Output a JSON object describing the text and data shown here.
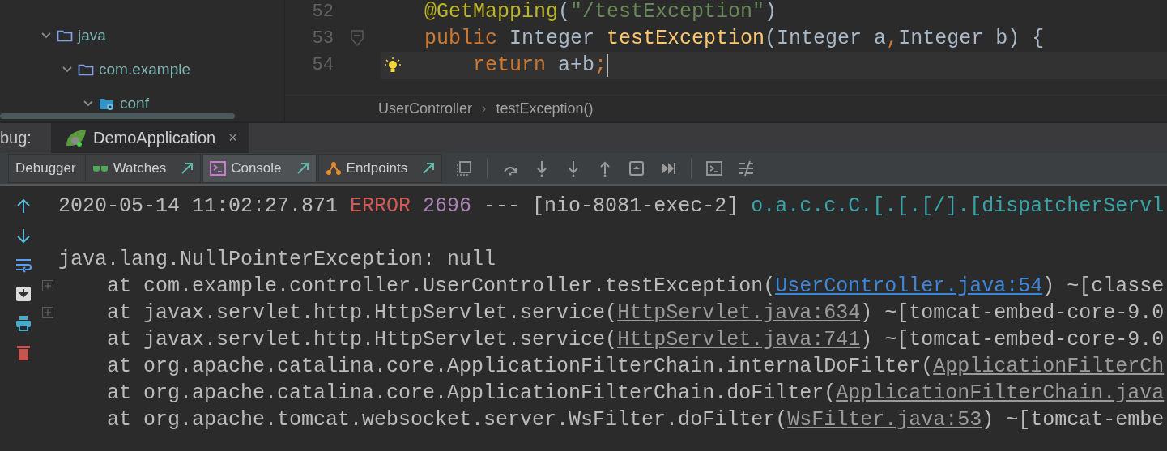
{
  "project_tree": [
    {
      "label": "java",
      "kind": "source",
      "expanded": true,
      "children": [
        {
          "label": "com.example",
          "kind": "package",
          "expanded": true,
          "children": [
            {
              "label": "conf",
              "kind": "config",
              "expanded": true
            }
          ]
        }
      ]
    }
  ],
  "editor": {
    "lines": [
      {
        "number": "52",
        "current": false,
        "fold_marker": false,
        "tokens": [
          {
            "kind": "annotation",
            "text": "@GetMapping"
          },
          {
            "kind": "plain",
            "text": "("
          },
          {
            "kind": "string",
            "text": "\"/testException\""
          },
          {
            "kind": "plain",
            "text": ")"
          }
        ]
      },
      {
        "number": "53",
        "current": false,
        "fold_marker": true,
        "tokens": [
          {
            "kind": "keyword",
            "text": "public"
          },
          {
            "kind": "plain",
            "text": " Integer "
          },
          {
            "kind": "method",
            "text": "testException"
          },
          {
            "kind": "plain",
            "text": "(Integer a"
          },
          {
            "kind": "keyword",
            "text": ","
          },
          {
            "kind": "plain",
            "text": "Integer b) {"
          }
        ]
      },
      {
        "number": "54",
        "current": true,
        "fold_marker": false,
        "tokens": [
          {
            "kind": "keyword",
            "text": "    return"
          },
          {
            "kind": "plain",
            "text": " a+b"
          },
          {
            "kind": "keyword",
            "text": ";"
          }
        ]
      }
    ],
    "breadcrumbs": [
      {
        "label": "UserController",
        "separator": "›"
      },
      {
        "label": "testException()"
      }
    ]
  },
  "debug": {
    "label": "bug:",
    "session_tab": {
      "label": "DemoApplication",
      "close": "×"
    },
    "tabs": [
      {
        "label": "Debugger",
        "selected": false,
        "pin": false,
        "kind": "debugger"
      },
      {
        "label": "Watches",
        "selected": false,
        "pin": true,
        "kind": "watches"
      },
      {
        "label": "Console",
        "selected": true,
        "pin": true,
        "kind": "console"
      },
      {
        "label": "Endpoints",
        "selected": false,
        "pin": true,
        "kind": "endpoints"
      }
    ]
  },
  "console": {
    "lines": [
      {
        "kind": "text",
        "fold_marker": false,
        "segments": [
          {
            "kind": "plain",
            "text": "2020-05-14 11:02:27.871 "
          },
          {
            "kind": "error",
            "text": "ERROR"
          },
          {
            "kind": "pid",
            "text": " 2696"
          },
          {
            "kind": "plain",
            "text": " --- [nio-8081-exec-2] "
          },
          {
            "kind": "logger",
            "text": "o.a.c.c.C.[.[.[/].[dispatcherServl"
          }
        ]
      },
      {
        "kind": "blank"
      },
      {
        "kind": "text",
        "fold_marker": false,
        "segments": [
          {
            "kind": "plain",
            "text": "java.lang.NullPointerException: null"
          }
        ]
      },
      {
        "kind": "text",
        "fold_marker": true,
        "segments": [
          {
            "kind": "plain",
            "text": "    at com.example.controller.UserController.testException("
          },
          {
            "kind": "link",
            "text": "UserController.java:54"
          },
          {
            "kind": "plain",
            "text": ") ~[classe"
          }
        ]
      },
      {
        "kind": "text",
        "fold_marker": true,
        "segments": [
          {
            "kind": "plain",
            "text": "    at javax.servlet.http.HttpServlet.service("
          },
          {
            "kind": "lib_link",
            "text": "HttpServlet.java:634"
          },
          {
            "kind": "plain",
            "text": ") ~[tomcat-embed-core-9.0"
          }
        ]
      },
      {
        "kind": "text",
        "fold_marker": false,
        "segments": [
          {
            "kind": "plain",
            "text": "    at javax.servlet.http.HttpServlet.service("
          },
          {
            "kind": "lib_link",
            "text": "HttpServlet.java:741"
          },
          {
            "kind": "plain",
            "text": ") ~[tomcat-embed-core-9.0"
          }
        ]
      },
      {
        "kind": "text",
        "fold_marker": false,
        "segments": [
          {
            "kind": "plain",
            "text": "    at org.apache.catalina.core.ApplicationFilterChain.internalDoFilter("
          },
          {
            "kind": "lib_link",
            "text": "ApplicationFilterCh"
          }
        ]
      },
      {
        "kind": "text",
        "fold_marker": false,
        "segments": [
          {
            "kind": "plain",
            "text": "    at org.apache.catalina.core.ApplicationFilterChain.doFilter("
          },
          {
            "kind": "lib_link",
            "text": "ApplicationFilterChain.java"
          }
        ]
      },
      {
        "kind": "text",
        "fold_marker": false,
        "segments": [
          {
            "kind": "plain",
            "text": "    at org.apache.tomcat.websocket.server.WsFilter.doFilter("
          },
          {
            "kind": "lib_link",
            "text": "WsFilter.java:53"
          },
          {
            "kind": "plain",
            "text": ") ~[tomcat-embe"
          }
        ]
      }
    ]
  }
}
